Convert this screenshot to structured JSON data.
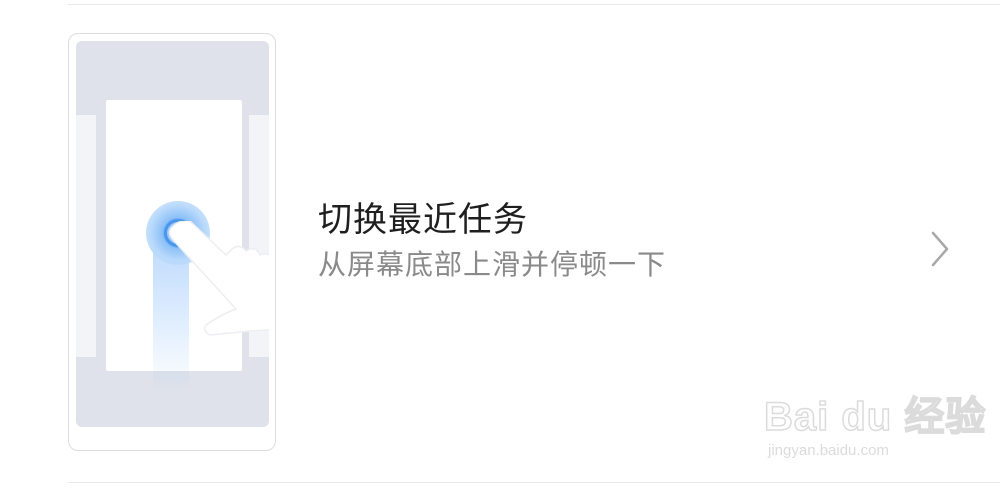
{
  "gesture": {
    "title": "切换最近任务",
    "description": "从屏幕底部上滑并停顿一下",
    "illustration_icon": "swipe-up-hold-illustration",
    "chevron_icon": "chevron-right-icon"
  },
  "watermark": {
    "logo_text": "Bai du 经验",
    "url": "jingyan.baidu.com"
  },
  "colors": {
    "background": "#ffffff",
    "title_text": "#1f1f1f",
    "subtitle_text": "#8a8a8a",
    "divider": "#e9e9e9",
    "touch_accent": "#4b97ee"
  }
}
